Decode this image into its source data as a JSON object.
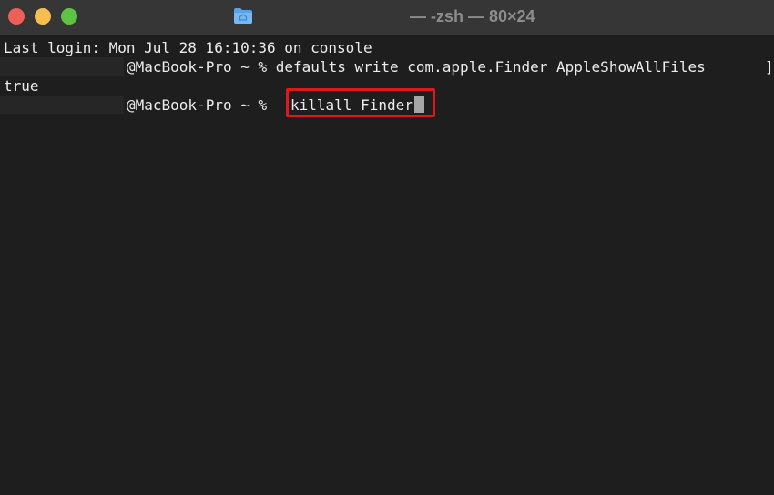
{
  "window": {
    "title": "— -zsh — 80×24",
    "colors": {
      "close": "#ee5f57",
      "minimize": "#f6be4f",
      "maximize": "#5dc443",
      "highlight": "#e1161e"
    }
  },
  "terminal": {
    "login_line": "Last login: Mon Jul 28 16:10:36 on console",
    "prompt": "@MacBook-Pro ~ % ",
    "command_1": "defaults write com.apple.Finder AppleShowAllFiles",
    "command_1_overflow": "]",
    "output_1": "true",
    "command_2": "killall Finder"
  }
}
